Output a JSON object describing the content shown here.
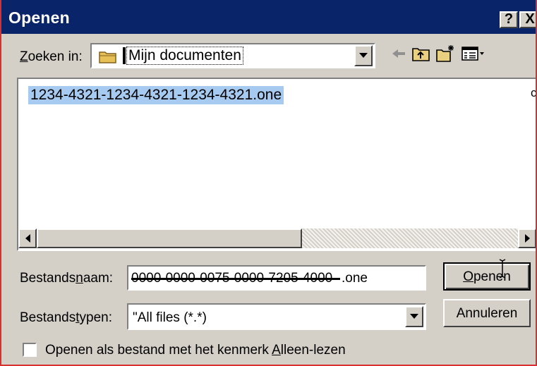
{
  "window": {
    "title": "Openen",
    "help_label": "?",
    "close_label": "X"
  },
  "lookin": {
    "label_pre": "",
    "label_ul": "Z",
    "label_post": "oeken in:",
    "value": "Mijn documenten"
  },
  "toolbar": {
    "back": "back-arrow-icon",
    "up": "up-folder-icon",
    "newfolder": "new-folder-icon",
    "views": "views-menu-icon"
  },
  "filelist": {
    "items": [
      "1234-4321-1234-4321-1234-4321.one"
    ],
    "cut_off_right": "c"
  },
  "filename": {
    "label_pre": "Bestands",
    "label_ul": "n",
    "label_post": "aam:",
    "value_redacted": "0000-0000-0075-0000-7205-4000",
    "value_suffix": ".one"
  },
  "filetype": {
    "label_pre": "Bestands",
    "label_ul": "t",
    "label_post": "ypen:",
    "value": "\"All files (*.*)"
  },
  "buttons": {
    "open_ul": "O",
    "open_rest": "penen",
    "cancel": "Annuleren"
  },
  "readonly": {
    "label_pre": "Openen als bestand met het kenmerk ",
    "label_ul": "A",
    "label_post": "lleen-lezen",
    "checked": false
  },
  "colors": {
    "titlebar": "#0a246a",
    "selection": "#a6caf0",
    "face": "#d4d0c8",
    "border_red": "#d83030"
  }
}
